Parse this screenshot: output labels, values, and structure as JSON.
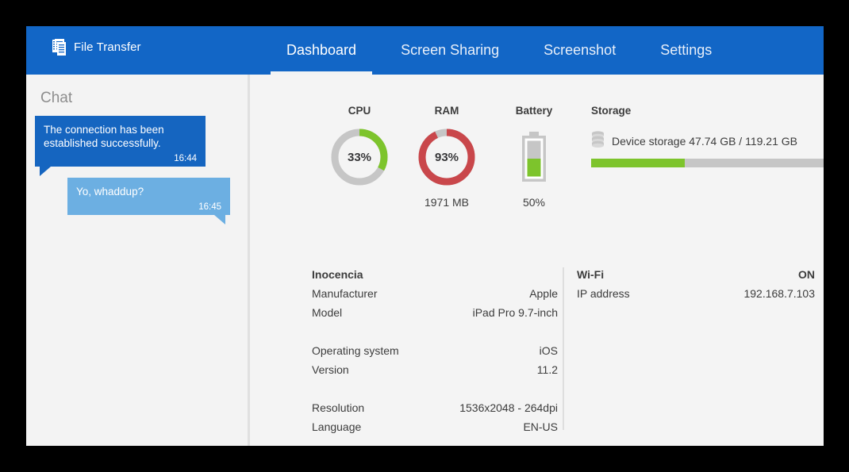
{
  "brand": {
    "label": "File Transfer",
    "icon": "document-lines-icon"
  },
  "nav": {
    "tabs": [
      {
        "label": "Dashboard",
        "active": true
      },
      {
        "label": "Screen Sharing",
        "active": false
      },
      {
        "label": "Screenshot",
        "active": false
      },
      {
        "label": "Settings",
        "active": false
      }
    ]
  },
  "sidebar": {
    "title": "Chat",
    "messages": [
      {
        "text": "The connection has been established successfully.",
        "time": "16:44",
        "direction": "incoming"
      },
      {
        "text": "Yo, whaddup?",
        "time": "16:45",
        "direction": "outgoing"
      }
    ]
  },
  "gauges": {
    "cpu": {
      "title": "CPU",
      "value_label": "33%",
      "percent": 33,
      "color": "#7dc42c",
      "track": "#c6c6c6"
    },
    "ram": {
      "title": "RAM",
      "value_label": "93%",
      "percent": 93,
      "sub": "1971 MB",
      "color": "#c9474b",
      "track": "#c6c6c6"
    },
    "battery": {
      "title": "Battery",
      "value_label": "50%",
      "percent": 50,
      "color": "#7dc42c",
      "icon": "battery-icon"
    }
  },
  "storage": {
    "title": "Storage",
    "icon": "disk-stack-icon",
    "label": "Device storage 47.74 GB / 119.21 GB",
    "used_gb": 47.74,
    "total_gb": 119.21,
    "percent": 40
  },
  "device": {
    "name": "Inocencia",
    "rows": [
      {
        "key": "Manufacturer",
        "value": "Apple"
      },
      {
        "key": "Model",
        "value": "iPad Pro 9.7-inch"
      },
      {
        "key": "Operating system",
        "value": "iOS"
      },
      {
        "key": "Version",
        "value": "11.2"
      },
      {
        "key": "Resolution",
        "value": "1536x2048 - 264dpi"
      },
      {
        "key": "Language",
        "value": "EN-US"
      }
    ]
  },
  "network": {
    "title": "Wi-Fi",
    "status": "ON",
    "ip_key": "IP address",
    "ip_value": "192.168.7.103"
  },
  "colors": {
    "header_blue": "#1266c6",
    "bubble_in": "#1565c0",
    "bubble_out": "#6cafe2",
    "green": "#7dc42c",
    "red": "#c9474b",
    "gray_track": "#c6c6c6"
  }
}
